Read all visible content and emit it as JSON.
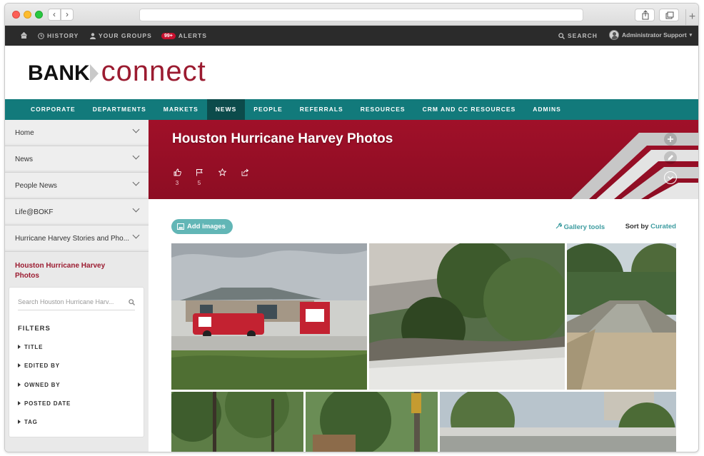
{
  "browser": {
    "back_icon": "chevron-left-icon",
    "forward_icon": "chevron-right-icon",
    "url": ""
  },
  "topbar": {
    "home_icon": "home-icon",
    "history": "HISTORY",
    "your_groups": "YOUR GROUPS",
    "alerts_badge": "99+",
    "alerts": "ALERTS",
    "search": "SEARCH",
    "user": "Administrator Support"
  },
  "logo": {
    "bank": "BANK",
    "connect": "connect"
  },
  "main_nav": {
    "tabs": [
      {
        "label": "CORPORATE"
      },
      {
        "label": "DEPARTMENTS"
      },
      {
        "label": "MARKETS"
      },
      {
        "label": "NEWS",
        "active": true
      },
      {
        "label": "PEOPLE"
      },
      {
        "label": "REFERRALS"
      },
      {
        "label": "RESOURCES"
      },
      {
        "label": "CRM AND CC RESOURCES"
      },
      {
        "label": "ADMINS"
      }
    ]
  },
  "sidebar": {
    "items": [
      {
        "label": "Home"
      },
      {
        "label": "News"
      },
      {
        "label": "People News"
      },
      {
        "label": "Life@BOKF"
      },
      {
        "label": "Hurricane Harvey Stories and Pho..."
      }
    ],
    "current_page": "Houston Hurricane Harvey Photos",
    "search_placeholder": "Search Houston Hurricane Harv...",
    "filters_title": "FILTERS",
    "filters": [
      "TITLE",
      "EDITED BY",
      "OWNED BY",
      "POSTED DATE",
      "TAG"
    ]
  },
  "hero": {
    "title": "Houston Hurricane Harvey Photos",
    "likes": "3",
    "flags": "5",
    "bg_color": "#9b1027"
  },
  "gallery": {
    "add_images": "Add images",
    "gallery_tools": "Gallery tools",
    "sort_label": "Sort by",
    "sort_value": "Curated"
  },
  "colors": {
    "teal": "#127a7b",
    "maroon": "#9b1b30",
    "accent": "#3d9ca0"
  }
}
